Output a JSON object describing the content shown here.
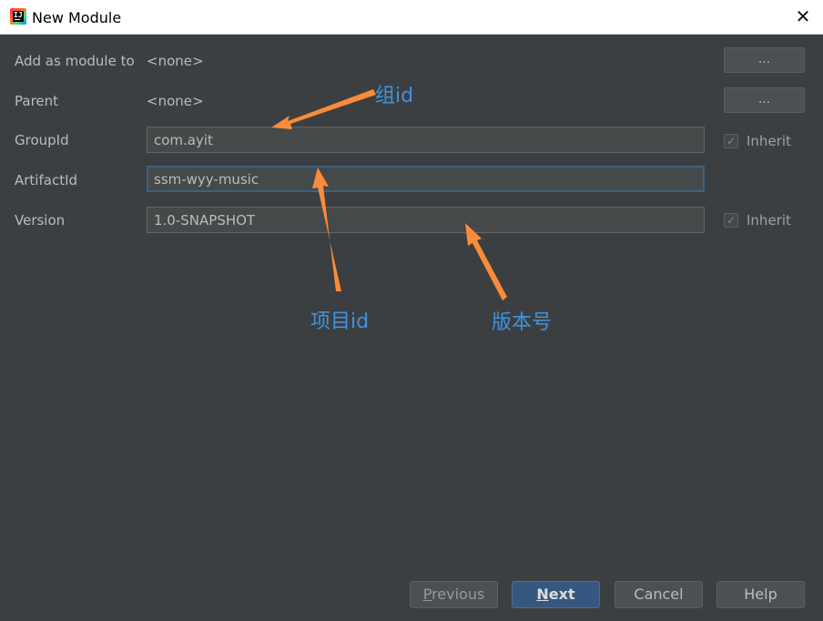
{
  "window": {
    "title": "New Module",
    "close_glyph": "✕"
  },
  "form": {
    "add_as_module_label": "Add as module to",
    "add_as_module_value": "<none>",
    "parent_label": "Parent",
    "parent_value": "<none>",
    "browse_label": "...",
    "group_id_label": "GroupId",
    "group_id_value": "com.ayit",
    "artifact_id_label": "ArtifactId",
    "artifact_id_value": "ssm-wyy-music",
    "version_label": "Version",
    "version_value": "1.0-SNAPSHOT",
    "inherit_label": "Inherit",
    "check_glyph": "✓"
  },
  "annotations": {
    "group": "组id",
    "artifact": "项目id",
    "version": "版本号",
    "color": "#f98c3b"
  },
  "footer": {
    "previous_mnemonic": "P",
    "previous_rest": "revious",
    "next_mnemonic": "N",
    "next_rest": "ext",
    "cancel": "Cancel",
    "help": "Help"
  }
}
